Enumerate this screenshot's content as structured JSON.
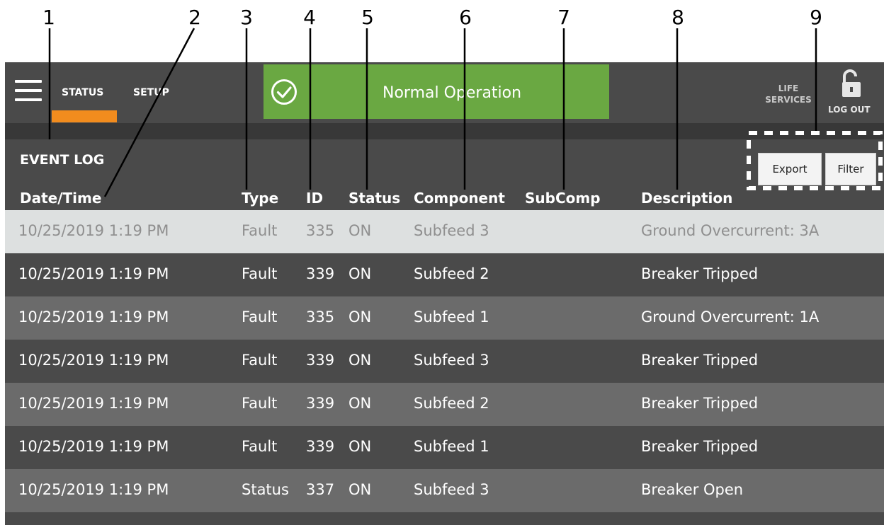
{
  "callouts": [
    "1",
    "2",
    "3",
    "4",
    "5",
    "6",
    "7",
    "8",
    "9"
  ],
  "nav": {
    "tabs": [
      {
        "label": "STATUS"
      },
      {
        "label": "SETUP"
      }
    ],
    "life_services": "LIFE SERVICES",
    "logout": "LOG OUT"
  },
  "banner": {
    "text": "Normal Operation",
    "color": "#6aa842"
  },
  "accent_color": "#f28c1e",
  "event_log": {
    "title": "EVENT LOG",
    "export_label": "Export",
    "filter_label": "Filter",
    "columns": [
      "Date/Time",
      "Type",
      "ID",
      "Status",
      "Component",
      "SubComp",
      "Description"
    ],
    "rows": [
      {
        "datetime": "10/25/2019 1:19 PM",
        "type": "Fault",
        "id": "335",
        "status": "ON",
        "component": "Subfeed 3",
        "subcomp": "",
        "description": "Ground Overcurrent: 3A"
      },
      {
        "datetime": "10/25/2019 1:19 PM",
        "type": "Fault",
        "id": "339",
        "status": "ON",
        "component": "Subfeed 2",
        "subcomp": "",
        "description": "Breaker Tripped"
      },
      {
        "datetime": "10/25/2019 1:19 PM",
        "type": "Fault",
        "id": "335",
        "status": "ON",
        "component": "Subfeed 1",
        "subcomp": "",
        "description": "Ground Overcurrent: 1A"
      },
      {
        "datetime": "10/25/2019 1:19 PM",
        "type": "Fault",
        "id": "339",
        "status": "ON",
        "component": "Subfeed 3",
        "subcomp": "",
        "description": "Breaker Tripped"
      },
      {
        "datetime": "10/25/2019 1:19 PM",
        "type": "Fault",
        "id": "339",
        "status": "ON",
        "component": "Subfeed 2",
        "subcomp": "",
        "description": "Breaker Tripped"
      },
      {
        "datetime": "10/25/2019 1:19 PM",
        "type": "Fault",
        "id": "339",
        "status": "ON",
        "component": "Subfeed 1",
        "subcomp": "",
        "description": "Breaker Tripped"
      },
      {
        "datetime": "10/25/2019 1:19 PM",
        "type": "Status",
        "id": "337",
        "status": "ON",
        "component": "Subfeed 3",
        "subcomp": "",
        "description": "Breaker Open"
      }
    ]
  }
}
